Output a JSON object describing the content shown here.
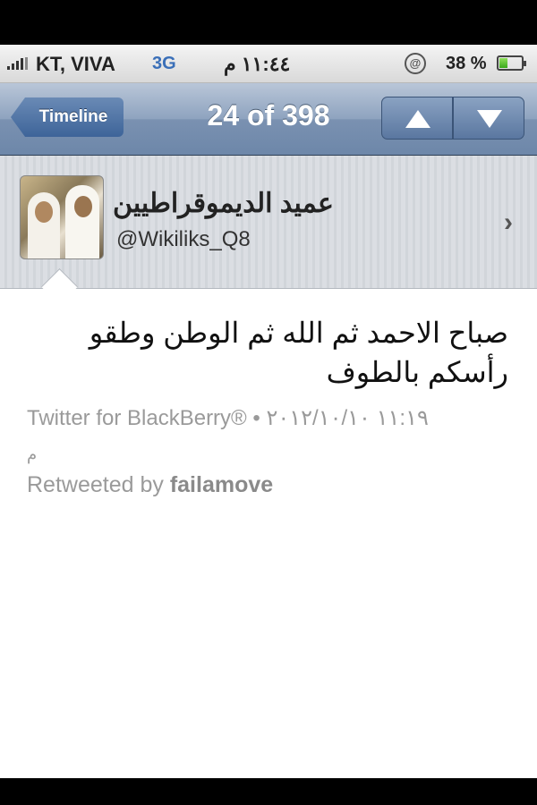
{
  "status_bar": {
    "carrier": "KT, VIVA",
    "network": "3G",
    "time": "١١:٤٤ م",
    "battery": "38 %",
    "battery_level": 0.38
  },
  "nav": {
    "back_label": "Timeline",
    "title": "24 of 398",
    "up_icon": "up-arrow-icon",
    "down_icon": "down-arrow-icon"
  },
  "profile": {
    "display_name": "عميد الديموقراطيين",
    "handle": "@Wikiliks_Q8"
  },
  "tweet": {
    "text": "صباح الاحمد ثم الله ثم الوطن وطقو رأسكم بالطوف",
    "source": "Twitter for BlackBerry®",
    "timestamp": "• ١١:١٩ ٢٠١٢/١٠/١٠",
    "am_pm": "م",
    "retweeted_prefix": "Retweeted by",
    "retweeted_by": "failamove"
  },
  "colors": {
    "nav_bar": "#7a91b1",
    "meta_text": "#9a9a9a",
    "network_3g": "#3a6fb8"
  }
}
